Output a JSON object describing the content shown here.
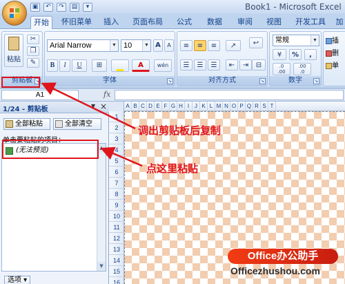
{
  "window": {
    "title": "Book1 - Microsoft Excel"
  },
  "qat": {
    "icons": [
      "save-icon",
      "undo-icon",
      "redo-icon",
      "print-preview-icon",
      "customize-icon"
    ]
  },
  "tabs": [
    {
      "label": "开始",
      "active": true
    },
    {
      "label": "怀旧菜单"
    },
    {
      "label": "插入"
    },
    {
      "label": "页面布局"
    },
    {
      "label": "公式"
    },
    {
      "label": "数据"
    },
    {
      "label": "审阅"
    },
    {
      "label": "视图"
    },
    {
      "label": "开发工具"
    },
    {
      "label": "加"
    }
  ],
  "ribbon": {
    "clipboard": {
      "label": "剪贴板",
      "paste_label": "粘贴"
    },
    "font": {
      "label": "字体",
      "font_name": "Arial Narrow",
      "font_size": "10",
      "bold": "B",
      "italic": "I",
      "underline": "U",
      "font_color_letter": "A",
      "grow": "A",
      "shrink": "A",
      "phonetic": "wén"
    },
    "alignment": {
      "label": "对齐方式"
    },
    "number": {
      "label": "数字",
      "format": "常规",
      "percent": "%",
      "comma": ",",
      "increase_decimal": ".0\n.00",
      "decrease_decimal": ".00\n.0"
    },
    "styles_partial": [
      "插",
      "删",
      "单"
    ]
  },
  "formula_bar": {
    "name_box": "A1",
    "fx": "fx",
    "value": ""
  },
  "clipboard_pane": {
    "title": "1/24 - 剪贴板",
    "paste_all": "全部粘贴",
    "clear_all": "全部清空",
    "instruction": "单击要粘贴的项目：",
    "items": [
      {
        "label": "(无法预览)"
      }
    ],
    "options": "选项 ▾"
  },
  "sheet": {
    "columns": [
      "A",
      "B",
      "C",
      "D",
      "E",
      "F",
      "G",
      "H",
      "I",
      "J",
      "K",
      "L",
      "M",
      "N",
      "O",
      "P",
      "Q",
      "R",
      "S",
      "T"
    ],
    "rows": [
      "1",
      "2",
      "3",
      "4",
      "5",
      "6",
      "7",
      "8",
      "9",
      "10",
      "11",
      "12",
      "13",
      "14",
      "15",
      "16"
    ]
  },
  "annotations": {
    "copy_note": "调出剪贴板后复制",
    "paste_note": "点这里粘贴",
    "color": "#e0141b"
  },
  "watermark": {
    "brand": "Office办公助手",
    "url": "Officezhushou.com"
  }
}
